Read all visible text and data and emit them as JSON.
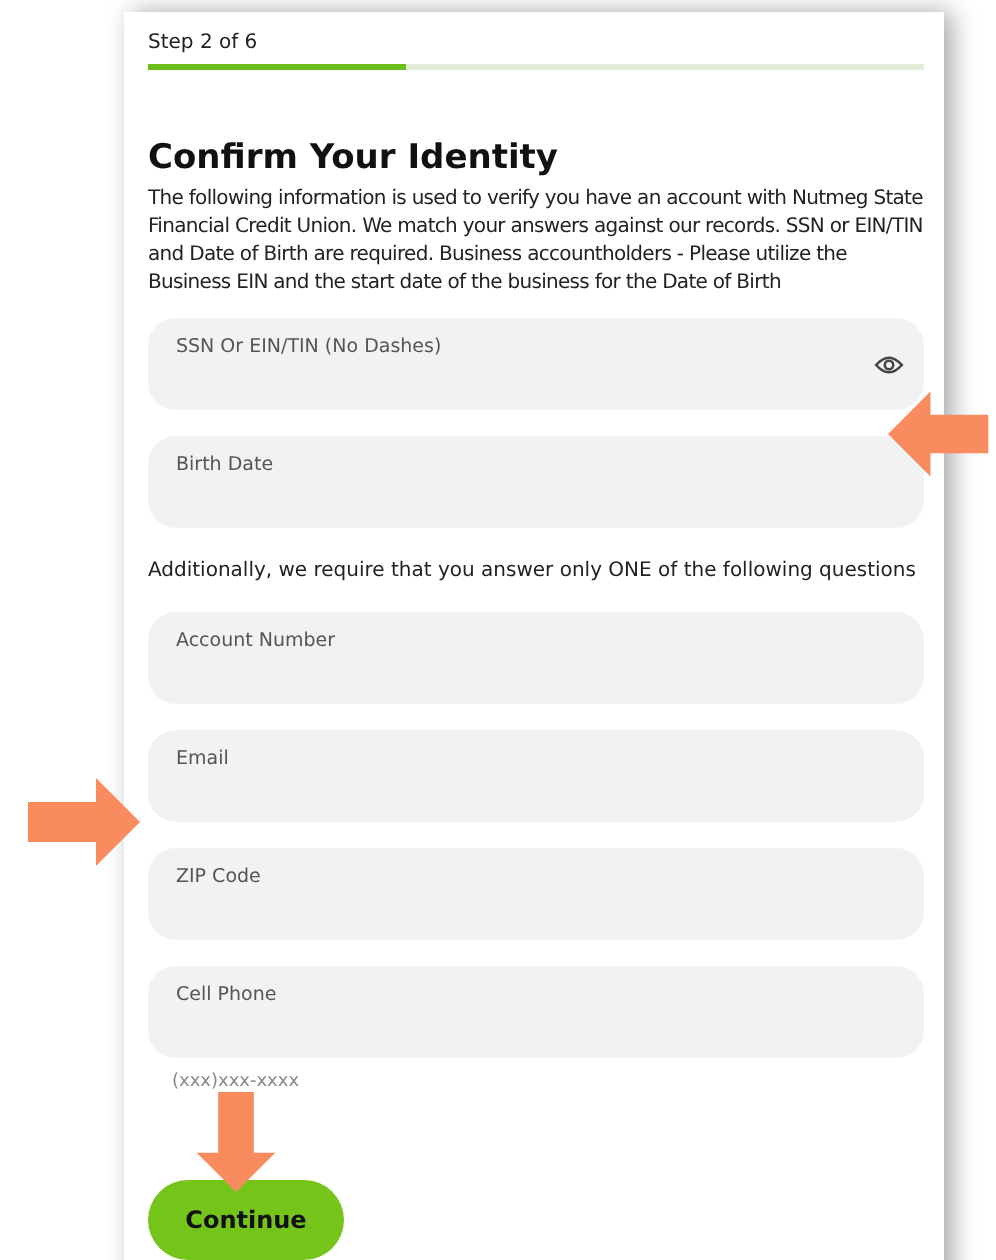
{
  "progress": {
    "label": "Step 2 of 6",
    "level": 0.333
  },
  "title": "Confirm Your Identity",
  "intro": "The following information is used to verify you have an account with Nutmeg State Financial Credit Union. We match your answers against our records. SSN or EIN/TIN and Date of Birth are required. Business accountholders - Please utilize the Business EIN and the start date of the business for the Date of Birth",
  "required_fields": [
    {
      "label": "SSN Or EIN/TIN (No Dashes)",
      "visibility_toggle": true
    },
    {
      "label": "Birth Date"
    }
  ],
  "additional_note": "Additionally, we require that you answer only ONE of the following questions",
  "optional_fields": [
    {
      "label": "Account Number"
    },
    {
      "label": "Email"
    },
    {
      "label": "ZIP Code"
    },
    {
      "label": "Cell Phone",
      "hint": "(xxx)xxx-xxxx"
    }
  ],
  "continue_button": "Continue",
  "annotations": [
    {
      "kind": "left"
    },
    {
      "kind": "right"
    },
    {
      "kind": "down"
    }
  ]
}
